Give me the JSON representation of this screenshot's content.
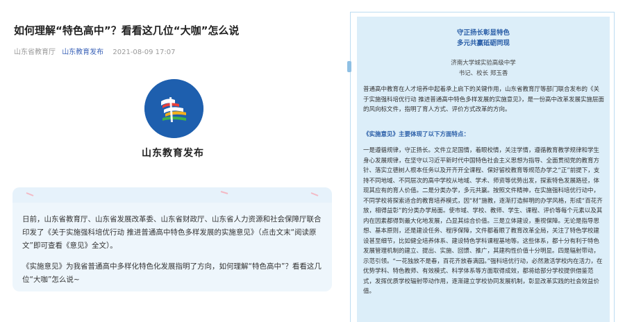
{
  "article": {
    "title": "如何理解“特色高中”？看看这几位“大咖”怎么说",
    "source": "山东省教育厅",
    "publisher": "山东教育发布",
    "date": "2021-08-09 17:07"
  },
  "account": {
    "name": "山东教育发布"
  },
  "summary": {
    "paragraph1": "日前，山东省教育厅、山东省发展改革委、山东省财政厅、山东省人力资源和社会保障厅联合印发了《关于实施强科培优行动 推进普通高中特色多样发展的实施意见》（点击文末“阅读原文”即可查看《意见》全文）。",
    "paragraph2": "《实施意见》为我省普通高中多样化特色化发展指明了方向，如何理解“特色高中”？看看这几位“大咖”怎么说~"
  },
  "document": {
    "headline1": "守正扬长彰显特色",
    "headline2": "多元共赢砥砺同现",
    "school": "济南大学城实验高级中学",
    "author": "书记、校长 郑玉香",
    "paragraph1": "普通高中教育在人才培养中起着承上启下的关键作用，山东省教育厅等部门联合发布的《关于实施强科培优行动 推进普通高中特色多样发展的实施意见》，是一份高中改革发展实施层面的风向标文件，指明了育人方式、评价方式改革的方向。",
    "section_title": "《实施意见》主要体现了以下方面特点：",
    "paragraph2": "一是遵循规律，守正扬长。文件立足国情，着眼校情，关注学情，遵循教育教学规律和学生身心发展规律，在坚守以习近平新时代中国特色社会主义思想为指导、全面贯彻党的教育方针、落实立德树人根本任务以及开齐开全课程、保好留校教育等规范办学之“正”前提下，支持不同地域、不同层次的高中学校从地域、学术、师资等优势出发，探索特色发展路径，体现其应有的育人价值。二是分类办学，多元共赢。按照文件精神，在实施强科培优行动中，不同学校将探索适合的教育培养模式，因“材”施教，逐渐打造鲜明的办学风格，形成“百花齐放，相得益彰”的分类办学局面。使市域、学校、教师、学生、课程、评价等每个元素以及其内在因素都得到最大化地发展，凸显其综合价值。三是立体建设，重视保障。无论是指导思想、基本原则，还是建设任务、程序保障，文件都着眼了教育改革全局，关注了特色学校建设甚至细节，比如健全培养体系、建设特色学科课程基地等。这些体系，都十分有利于特色发展管理机制的建立、提出、实施、回馈、推广，其建构性价值十分明显。四是辐射带动，示范引领。“一花独放不是春，百花齐放春满园。”强科培优行动，必然激活学校内在活力，在优势学科、特色教师、有效模式、科学体系等方面取得成效，都将给部分学校提供借鉴范式，发挥优质学校辐射带动作用，逐渐建立学校协同发展机制，彰显改革实践的社会效益价值。"
  },
  "colors": {
    "accent": "#2b5fa8",
    "logo_blue": "#1e5fae",
    "card_bg": "#eef6fc",
    "doc_bg": "#dceef9"
  }
}
